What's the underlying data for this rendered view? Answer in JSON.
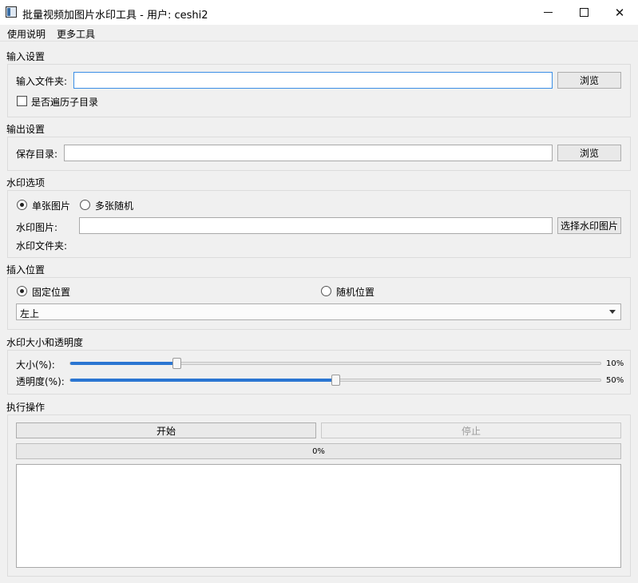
{
  "window": {
    "title": "批量视频加图片水印工具 - 用户: ceshi2",
    "min": "—",
    "max": "☐",
    "close": "✕"
  },
  "menu": {
    "items": [
      "使用说明",
      "更多工具"
    ]
  },
  "input_settings": {
    "title": "输入设置",
    "folder_label": "输入文件夹:",
    "folder_value": "",
    "browse_label": "浏览",
    "recursive_label": "是否遍历子目录",
    "recursive_checked": false
  },
  "output_settings": {
    "title": "输出设置",
    "dir_label": "保存目录:",
    "dir_value": "",
    "browse_label": "浏览"
  },
  "watermark_options": {
    "title": "水印选项",
    "single_label": "单张图片",
    "multi_label": "多张随机",
    "mode": "single",
    "image_label": "水印图片:",
    "image_value": "",
    "select_button": "选择水印图片",
    "folder_label": "水印文件夹:"
  },
  "insert_position": {
    "title": "插入位置",
    "fixed_label": "固定位置",
    "random_label": "随机位置",
    "mode": "fixed",
    "selected": "左上"
  },
  "size_opacity": {
    "title": "水印大小和透明度",
    "size_label": "大小(%):",
    "size_value": 10,
    "size_text": "10%",
    "opacity_label": "透明度(%):",
    "opacity_value": 50,
    "opacity_text": "50%"
  },
  "actions": {
    "title": "执行操作",
    "start_label": "开始",
    "stop_label": "停止",
    "progress": 0,
    "progress_text": "0%",
    "log": ""
  }
}
